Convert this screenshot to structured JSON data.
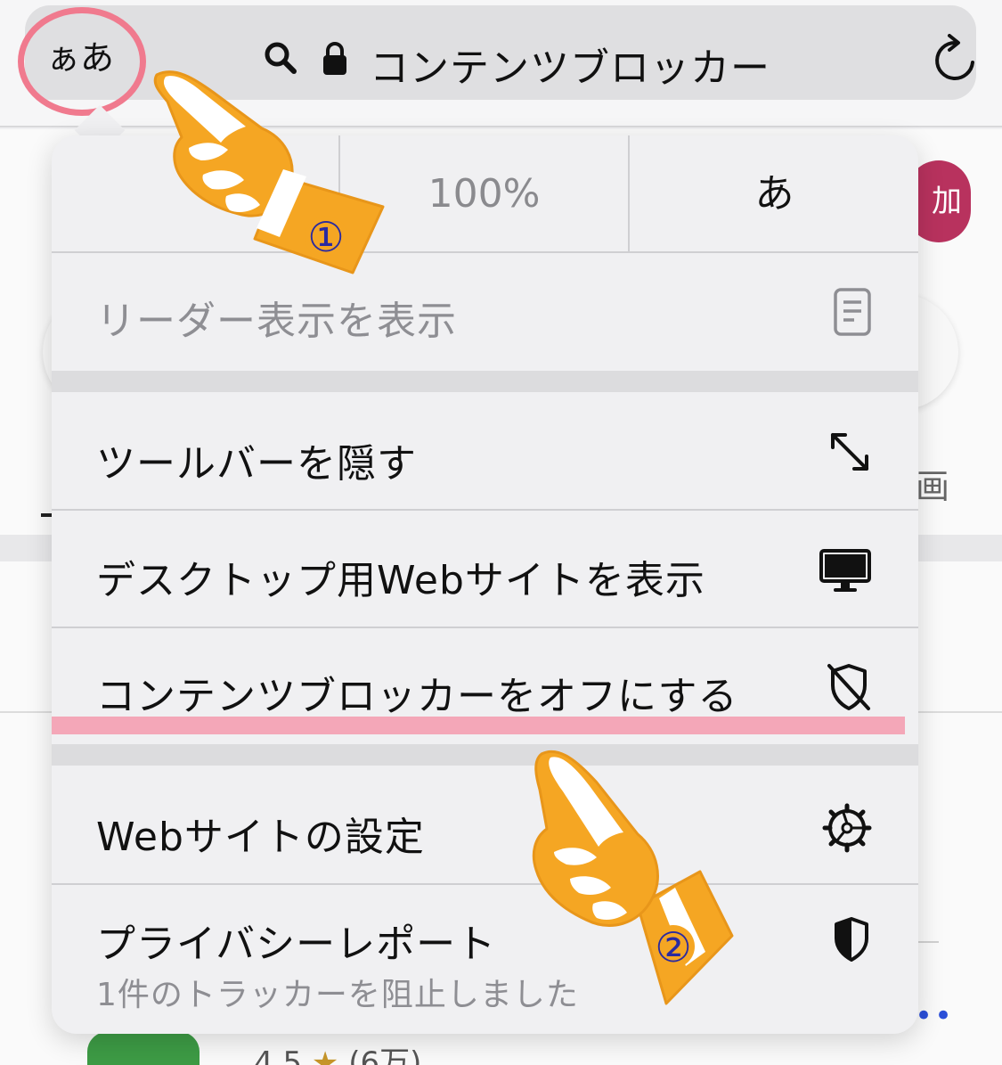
{
  "address_bar": {
    "aa_label": "ぁあ",
    "title": "コンテンツブロッカー"
  },
  "zoom": {
    "value": "100%",
    "font_char": "あ"
  },
  "menu": {
    "reader": "リーダー表示を表示",
    "hide_toolbar": "ツールバーを隠す",
    "desktop_site": "デスクトップ用Webサイトを表示",
    "content_blocker_off": "コンテンツブロッカーをオフにする",
    "website_settings": "Webサイトの設定",
    "privacy_report": "プライバシーレポート",
    "privacy_report_sub": "1件のトラッカーを阻止しました"
  },
  "annotations": {
    "step1": "①",
    "step2": "②"
  },
  "background": {
    "avatar_text": "加彦",
    "side_char": "画",
    "rating": "4.5",
    "rating_count": "(6万)"
  },
  "colors": {
    "highlight_circle": "#f07a8e",
    "underline": "#f4a7b8",
    "hand_fill": "#f5a623",
    "step_number": "#2a2aa0"
  }
}
